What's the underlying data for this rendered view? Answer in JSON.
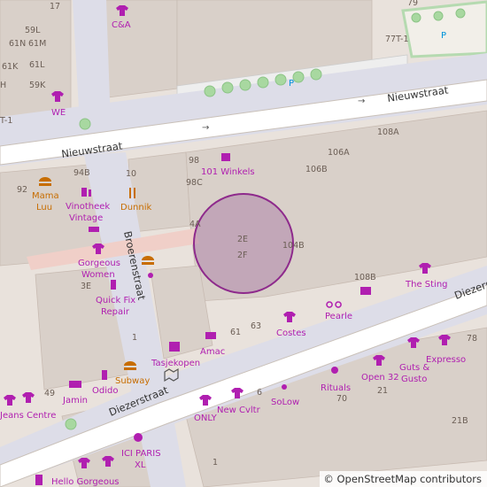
{
  "map": {
    "streets": {
      "nieuwstraat_left": "Nieuwstraat",
      "nieuwstraat_right": "Nieuwstraat",
      "broerenstraat": "Broerenstraat",
      "diezerstraat_left": "Diezerstraat",
      "diezerstraat_right": "Diezerstraat"
    },
    "house_numbers": {
      "n17": "17",
      "n59L": "59L",
      "n61N": "61N",
      "n61M": "61M",
      "n61K": "61K",
      "n61L": "61L",
      "nH": "H",
      "n59K": "59K",
      "nT1": "T-1",
      "n77T1": "77T-1",
      "n79": "79",
      "n108A": "108A",
      "n106A": "106A",
      "n106B": "106B",
      "n98": "98",
      "n98C": "98C",
      "n94B": "94B",
      "n10": "10",
      "n92": "92",
      "n4A": "4A",
      "n2E": "2E",
      "n2F": "2F",
      "n104B": "104B",
      "n108B": "108B",
      "n3E": "3E",
      "n1": "1",
      "n61": "61",
      "n63": "63",
      "n78": "78",
      "n21": "21",
      "n70": "70",
      "n6": "6",
      "n49": "49",
      "n21B": "21B",
      "n1b": "1"
    },
    "pois": {
      "ca": "C&A",
      "we": "WE",
      "winkels": "101 Winkels",
      "mama_luu_1": "Mama",
      "mama_luu_2": "Luu",
      "vinotheek_1": "Vinotheek",
      "vinotheek_2": "Vintage",
      "dunnik": "Dunnik",
      "gorgeous_1": "Gorgeous",
      "gorgeous_2": "Women",
      "quickfix_1": "Quick Fix",
      "quickfix_2": "Repair",
      "the_sting": "The Sting",
      "pearle": "Pearle",
      "costes": "Costes",
      "amac": "Amac",
      "tasjekopen": "Tasjekopen",
      "subway": "Subway",
      "odido": "Odido",
      "jamin": "Jamin",
      "jeans_centre": "Jeans Centre",
      "only": "ONLY",
      "new_cvltr": "New Cvltr",
      "solow": "SoLow",
      "rituals": "Rituals",
      "open32": "Open 32",
      "guts_1": "Guts &",
      "guts_2": "Gusto",
      "expresso": "Expresso",
      "ici_1": "ICI PARIS",
      "ici_2": "XL",
      "hello_gorgeous": "Hello Gorgeous"
    },
    "parking_labels": [
      "P",
      "P"
    ],
    "colors": {
      "background": "#e9e2dc",
      "building": "#d9d0c9",
      "road": "#ffffff",
      "pedestrian": "#dddde8",
      "shop": "#b01fb0",
      "food": "#c76d00",
      "marker_fill": "#ab7da8",
      "marker_stroke": "#8e2a8c",
      "tree": "#a8d8a0",
      "park": "#c8f0c8"
    }
  },
  "attribution": {
    "symbol": "©",
    "text": "OpenStreetMap contributors"
  }
}
